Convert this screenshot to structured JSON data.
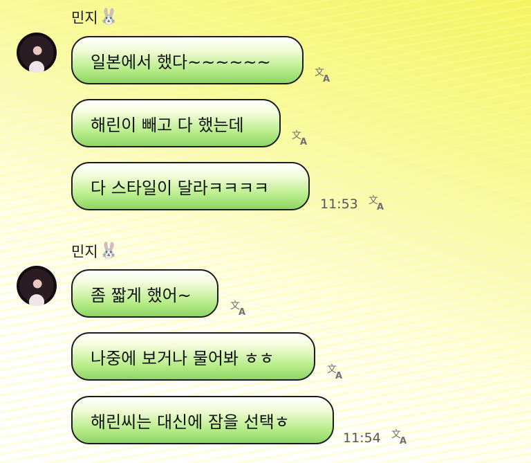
{
  "conversation": {
    "groups": [
      {
        "sender": {
          "name": "민지",
          "emoji": "🐰"
        },
        "messages": [
          {
            "text": "일본에서 했다~~~~~~"
          },
          {
            "text": "해린이 빼고 다 했는데"
          },
          {
            "text": "다 스타일이 달라ㅋㅋㅋㅋ",
            "time": "11:53"
          }
        ]
      },
      {
        "sender": {
          "name": "민지",
          "emoji": "🐰"
        },
        "messages": [
          {
            "text": "좀 짧게 했어~"
          },
          {
            "text": "나중에 보거나 물어봐 ㅎㅎ"
          },
          {
            "text": "해린씨는 대신에 잠을 선택ㅎ",
            "time": "11:54"
          }
        ]
      }
    ]
  },
  "icons": {
    "translate": "translate-icon",
    "avatar": "profile-avatar"
  }
}
